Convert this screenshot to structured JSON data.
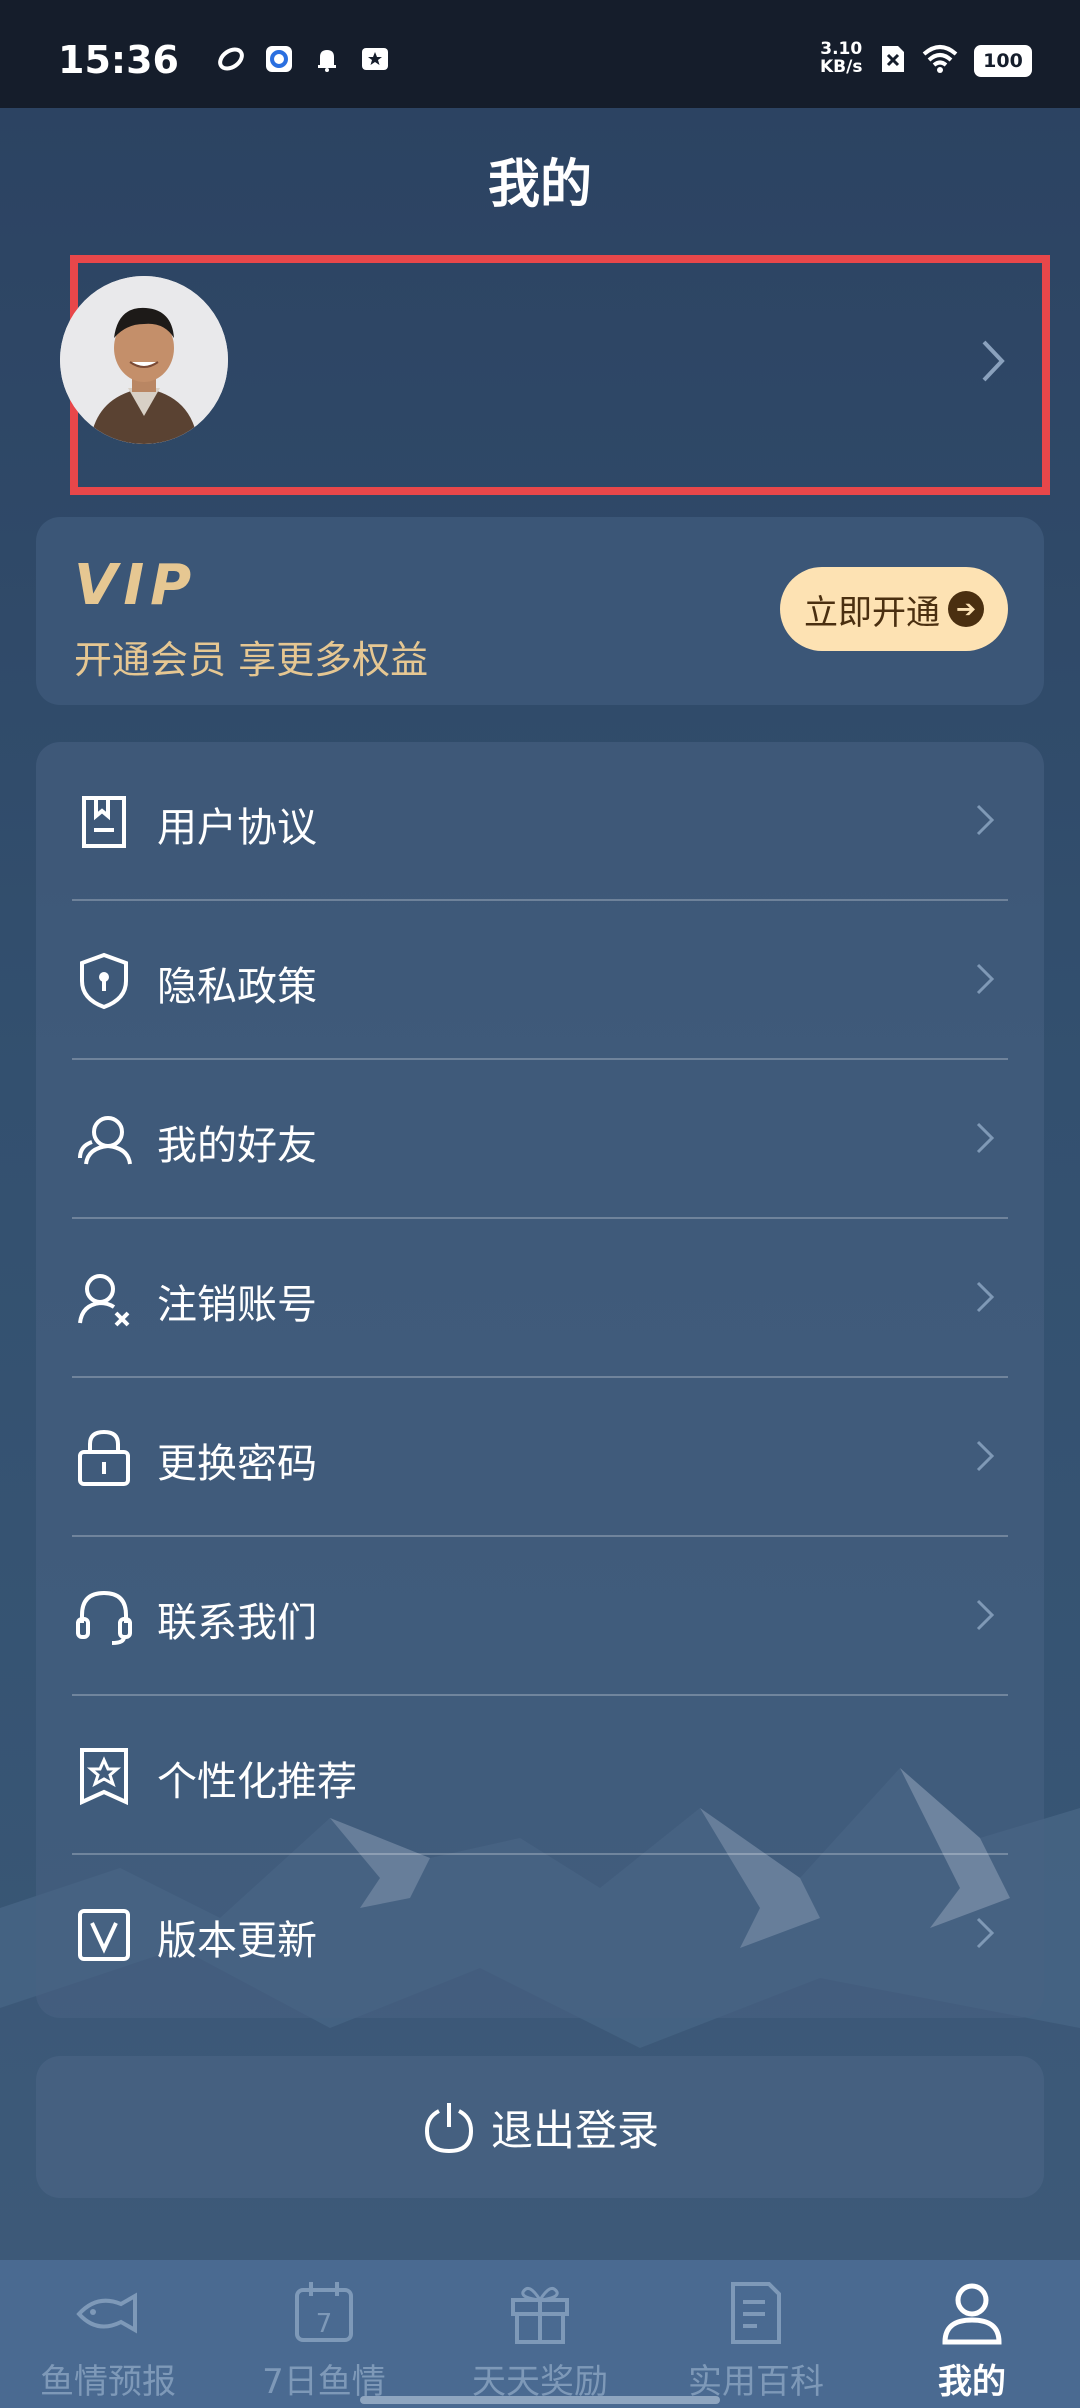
{
  "status_bar": {
    "time": "15:36",
    "net_speed_value": "3.10",
    "net_speed_unit": "KB/s",
    "battery": "100"
  },
  "header": {
    "title": "我的"
  },
  "vip": {
    "logo": "VIP",
    "subtitle": "开通会员 享更多权益",
    "button_label": "立即开通"
  },
  "menu": {
    "items": [
      {
        "label": "用户协议",
        "icon": "agreement-icon"
      },
      {
        "label": "隐私政策",
        "icon": "privacy-shield-icon"
      },
      {
        "label": "我的好友",
        "icon": "friends-icon"
      },
      {
        "label": "注销账号",
        "icon": "delete-account-icon"
      },
      {
        "label": "更换密码",
        "icon": "lock-icon"
      },
      {
        "label": "联系我们",
        "icon": "headset-icon"
      },
      {
        "label": "个性化推荐",
        "icon": "recommend-icon"
      },
      {
        "label": "版本更新",
        "icon": "version-icon"
      }
    ]
  },
  "logout": {
    "label": "退出登录"
  },
  "tabbar": {
    "tabs": [
      {
        "label": "鱼情预报",
        "icon": "fish-icon"
      },
      {
        "label": "7日鱼情",
        "icon": "calendar-7-icon"
      },
      {
        "label": "天天奖励",
        "icon": "gift-icon"
      },
      {
        "label": "实用百科",
        "icon": "document-icon"
      },
      {
        "label": "我的",
        "icon": "profile-icon"
      }
    ],
    "active_index": 4
  },
  "colors": {
    "highlight_border": "#e8474a",
    "vip_gold": "#e6c792",
    "vip_button_bg": "#fde2b3",
    "tab_inactive": "#7e99b8",
    "tab_active": "#ffffff"
  }
}
